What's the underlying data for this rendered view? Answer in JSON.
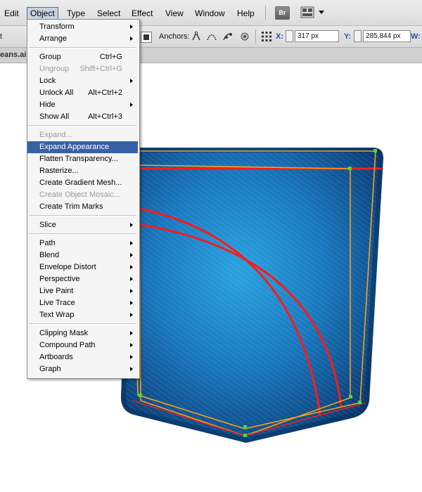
{
  "menubar": {
    "items": [
      "Edit",
      "Object",
      "Type",
      "Select",
      "Effect",
      "View",
      "Window",
      "Help"
    ],
    "bridge_label": "Br"
  },
  "controlbar": {
    "left_fragment": "t",
    "anchors_label": "Anchors:",
    "x_label": "X:",
    "x_value": "317 px",
    "y_label": "Y:",
    "y_value": "285,844 px",
    "w_label": "W:"
  },
  "document_tab": {
    "label": "eans.ai"
  },
  "object_menu": {
    "groups": [
      [
        {
          "label": "Transform",
          "submenu": true
        },
        {
          "label": "Arrange",
          "submenu": true
        }
      ],
      [
        {
          "label": "Group",
          "shortcut": "Ctrl+G"
        },
        {
          "label": "Ungroup",
          "shortcut": "Shift+Ctrl+G",
          "disabled": true
        },
        {
          "label": "Lock",
          "submenu": true
        },
        {
          "label": "Unlock All",
          "shortcut": "Alt+Ctrl+2"
        },
        {
          "label": "Hide",
          "submenu": true
        },
        {
          "label": "Show All",
          "shortcut": "Alt+Ctrl+3"
        }
      ],
      [
        {
          "label": "Expand...",
          "disabled": true
        },
        {
          "label": "Expand Appearance",
          "highlighted": true
        },
        {
          "label": "Flatten Transparency..."
        },
        {
          "label": "Rasterize..."
        },
        {
          "label": "Create Gradient Mesh..."
        },
        {
          "label": "Create Object Mosaic...",
          "disabled": true
        },
        {
          "label": "Create Trim Marks"
        }
      ],
      [
        {
          "label": "Slice",
          "submenu": true
        }
      ],
      [
        {
          "label": "Path",
          "submenu": true
        },
        {
          "label": "Blend",
          "submenu": true
        },
        {
          "label": "Envelope Distort",
          "submenu": true
        },
        {
          "label": "Perspective",
          "submenu": true
        },
        {
          "label": "Live Paint",
          "submenu": true
        },
        {
          "label": "Live Trace",
          "submenu": true
        },
        {
          "label": "Text Wrap",
          "submenu": true
        }
      ],
      [
        {
          "label": "Clipping Mask",
          "submenu": true
        },
        {
          "label": "Compound Path",
          "submenu": true
        },
        {
          "label": "Artboards",
          "submenu": true
        },
        {
          "label": "Graph",
          "submenu": true
        }
      ]
    ]
  },
  "colors": {
    "menu_highlight": "#3860a5",
    "denim_light": "#1f93d6",
    "denim_dark": "#0d3f78",
    "stitch_red": "#ff1a1a",
    "selection_orange": "#f7a11b",
    "anchor_green": "#36e23a"
  }
}
